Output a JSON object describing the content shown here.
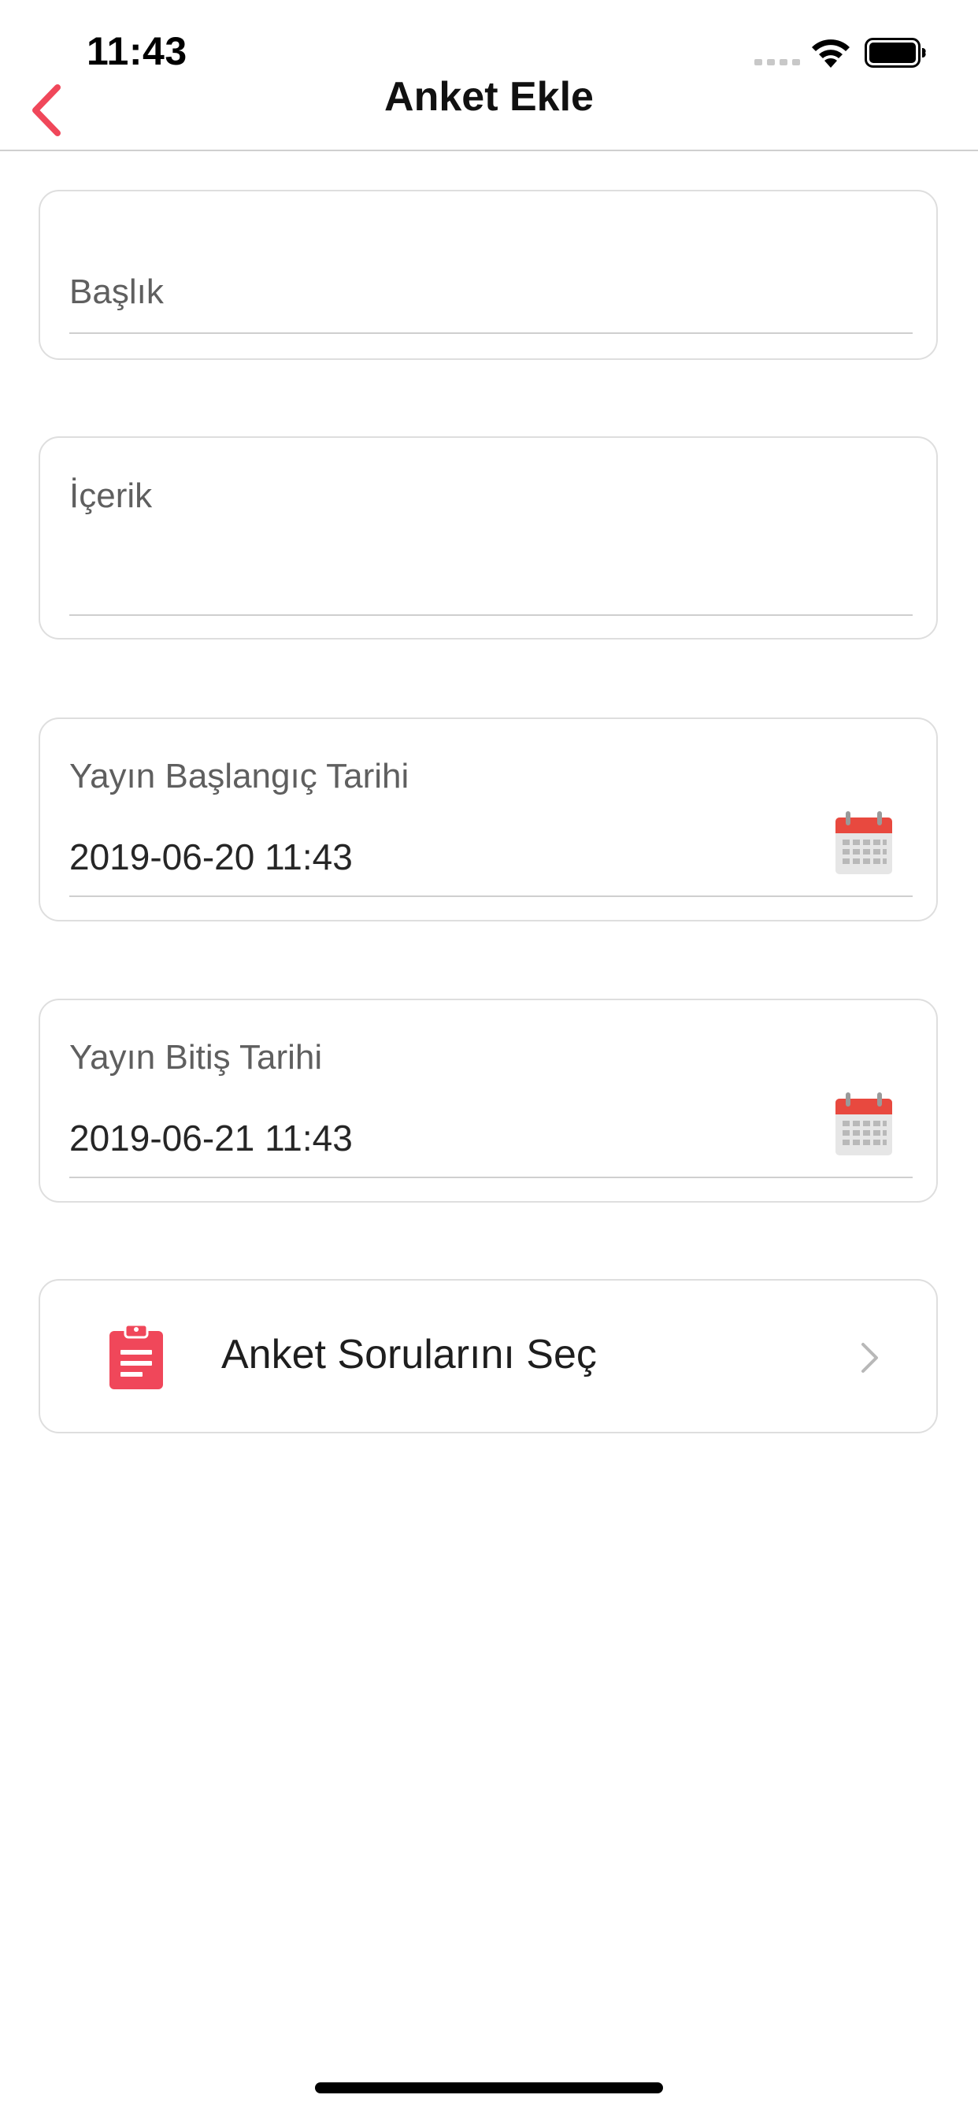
{
  "status_bar": {
    "time": "11:43"
  },
  "nav": {
    "title": "Anket Ekle",
    "back_icon": "chevron-left-icon"
  },
  "form": {
    "title_field": {
      "placeholder": "Başlık",
      "value": ""
    },
    "content_field": {
      "placeholder": "İçerik",
      "value": ""
    },
    "start_date_field": {
      "label": "Yayın Başlangıç Tarihi",
      "value": "2019-06-20 11:43",
      "icon": "calendar-icon"
    },
    "end_date_field": {
      "label": "Yayın Bitiş Tarihi",
      "value": "2019-06-21 11:43",
      "icon": "calendar-icon"
    },
    "questions_row": {
      "label": "Anket Sorularını Seç",
      "icon": "clipboard-icon",
      "trailing_icon": "chevron-right-icon"
    }
  },
  "colors": {
    "accent": "#f0475a",
    "calendar_red": "#e8493f",
    "border": "#dedede",
    "divider": "#cfcfcf"
  }
}
